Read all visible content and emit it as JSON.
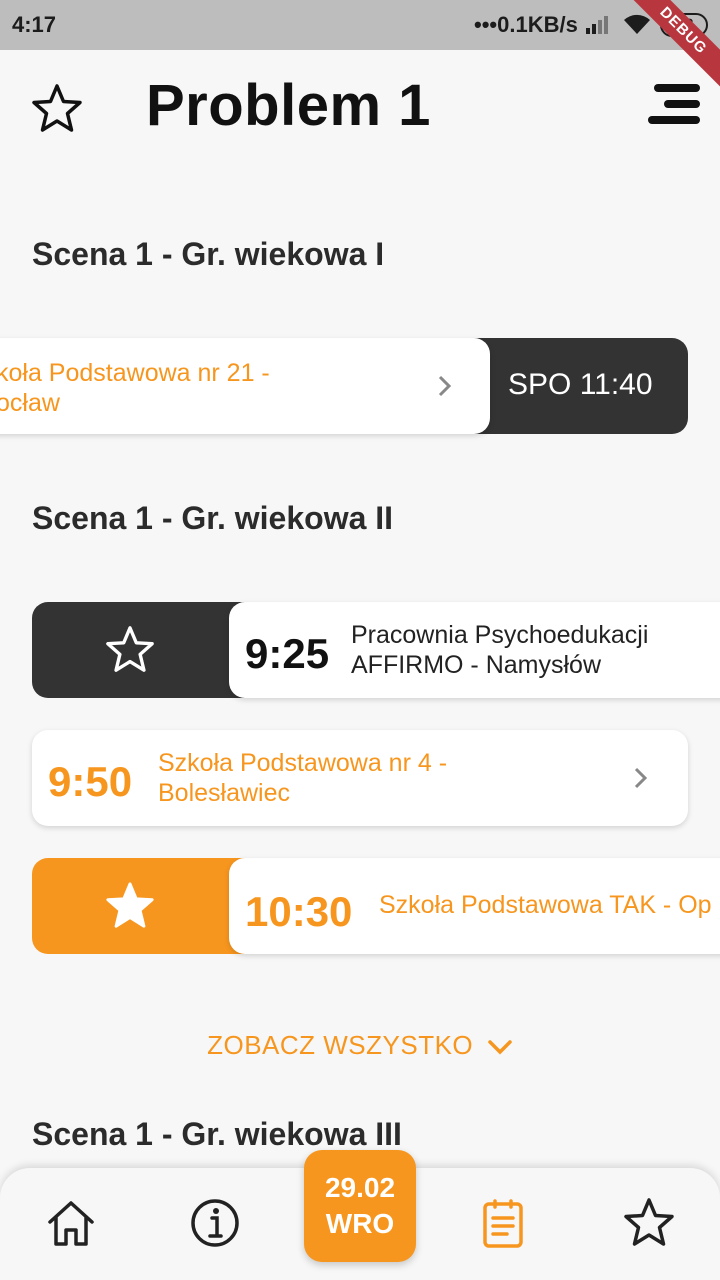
{
  "status_bar": {
    "time": "4:17",
    "network": "•••0.1KB/s",
    "battery": "38",
    "debug": "DEBUG"
  },
  "header": {
    "title": "Problem 1"
  },
  "sections": [
    {
      "title": "Scena 1 - Gr. wiekowa I"
    },
    {
      "title": "Scena 1 - Gr. wiekowa II"
    },
    {
      "title": "Scena 1 - Gr. wiekowa III"
    }
  ],
  "cards": {
    "s1_row1": {
      "name_line1": "koła Podstawowa nr 21 -",
      "name_line2": "ocław",
      "action": "SPO 11:40"
    },
    "s2_row1": {
      "time": "9:25",
      "name_line1": "Pracownia Psychoedukacji",
      "name_line2": "AFFIRMO - Namysłów"
    },
    "s2_row2": {
      "time": "9:50",
      "name_line1": "Szkoła Podstawowa nr 4 -",
      "name_line2": "Bolesławiec"
    },
    "s2_row3": {
      "time": "10:30",
      "name_line1": "Szkoła Podstawowa TAK - Op"
    }
  },
  "see_all": "ZOBACZ WSZYSTKO",
  "bottom_nav": {
    "date_line1": "29.02",
    "date_line2": "WRO",
    "items": [
      "home-icon",
      "info-icon",
      "schedule-icon",
      "favorites-icon"
    ]
  },
  "colors": {
    "accent": "#f7961e",
    "dark": "#333333",
    "background": "#f7f7f7"
  }
}
